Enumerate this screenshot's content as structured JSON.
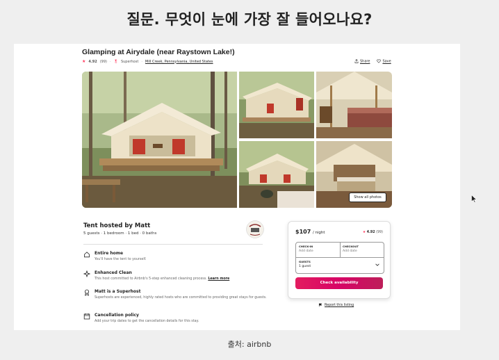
{
  "slide": {
    "question": "질문. 무엇이 눈에 가장 잘 들어오나요?",
    "caption": "출처: airbnb"
  },
  "listing": {
    "title": "Glamping at Airydale (near Raystown Lake!)",
    "rating": "4.92",
    "reviews": "(99)",
    "host_badge": "Superhost",
    "separator": "·",
    "location": "Mill Creek, Pennsylvania, United States",
    "share_label": "Share",
    "save_label": "Save",
    "show_all_photos": "Show all photos"
  },
  "host": {
    "heading": "Tent hosted by Matt",
    "summary": "5 guests · 1 bedroom · 1 bed · 0 baths"
  },
  "features": [
    {
      "icon": "home-icon",
      "title": "Entire home",
      "desc": "You'll have the tent to yourself."
    },
    {
      "icon": "sparkle-icon",
      "title": "Enhanced Clean",
      "desc": "This host committed to Airbnb's 5-step enhanced cleaning process.",
      "link": "Learn more"
    },
    {
      "icon": "medal-icon",
      "title": "Matt is a Superhost",
      "desc": "Superhosts are experienced, highly rated hosts who are committed to providing great stays for guests."
    },
    {
      "icon": "calendar-icon",
      "title": "Cancellation policy",
      "desc": "Add your trip dates to get the cancellation details for this stay."
    }
  ],
  "booking": {
    "price": "$107",
    "per": "/ night",
    "rating": "4.92",
    "reviews": "(99)",
    "checkin_label": "CHECK-IN",
    "checkin_value": "Add date",
    "checkout_label": "CHECKOUT",
    "checkout_value": "Add date",
    "guests_label": "GUESTS",
    "guests_value": "1 guest",
    "button": "Check availability",
    "report": "Report this listing"
  },
  "colors": {
    "brand": "#e31c5f",
    "star": "#ff385c"
  }
}
